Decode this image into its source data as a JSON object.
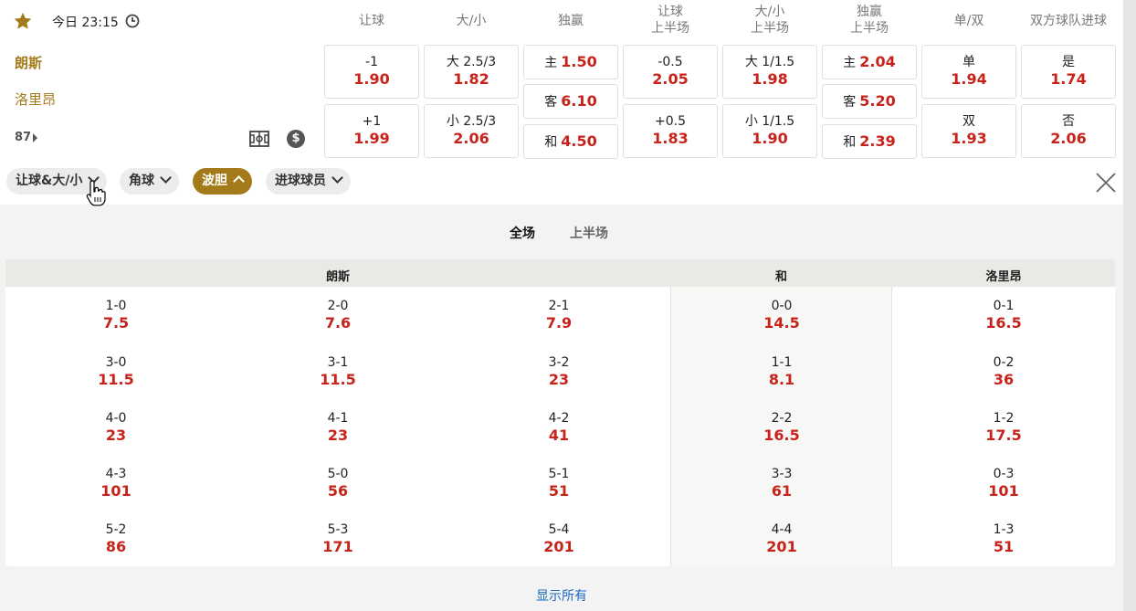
{
  "match": {
    "time": "今日 23:15",
    "home": "朗斯",
    "away": "洛里昂",
    "minute": "87"
  },
  "markets": [
    {
      "header": [
        "让球"
      ],
      "cells": [
        {
          "label": "-1",
          "odd": "1.90"
        },
        {
          "label": "+1",
          "odd": "1.99"
        }
      ]
    },
    {
      "header": [
        "大/小"
      ],
      "cells": [
        {
          "label": "大 2.5/3",
          "odd": "1.82"
        },
        {
          "label": "小 2.5/3",
          "odd": "2.06"
        }
      ]
    },
    {
      "header": [
        "独赢"
      ],
      "cells": [
        {
          "label": "主",
          "odd": "1.50"
        },
        {
          "label": "客",
          "odd": "6.10"
        },
        {
          "label": "和",
          "odd": "4.50"
        }
      ]
    },
    {
      "header": [
        "让球",
        "上半场"
      ],
      "cells": [
        {
          "label": "-0.5",
          "odd": "2.05"
        },
        {
          "label": "+0.5",
          "odd": "1.83"
        }
      ]
    },
    {
      "header": [
        "大/小",
        "上半场"
      ],
      "cells": [
        {
          "label": "大 1/1.5",
          "odd": "1.98"
        },
        {
          "label": "小 1/1.5",
          "odd": "1.90"
        }
      ]
    },
    {
      "header": [
        "独赢",
        "上半场"
      ],
      "cells": [
        {
          "label": "主",
          "odd": "2.04"
        },
        {
          "label": "客",
          "odd": "5.20"
        },
        {
          "label": "和",
          "odd": "2.39"
        }
      ]
    },
    {
      "header": [
        "单/双"
      ],
      "cells": [
        {
          "label": "单",
          "odd": "1.94"
        },
        {
          "label": "双",
          "odd": "1.93"
        }
      ]
    },
    {
      "header": [
        "双方球队进球"
      ],
      "cells": [
        {
          "label": "是",
          "odd": "1.74"
        },
        {
          "label": "否",
          "odd": "2.06"
        }
      ]
    }
  ],
  "chips": [
    {
      "label": "让球&大/小",
      "active": false
    },
    {
      "label": "角球",
      "active": false
    },
    {
      "label": "波胆",
      "active": true
    },
    {
      "label": "进球球员",
      "active": false
    }
  ],
  "tabs": [
    "全场",
    "上半场"
  ],
  "grid_headers": {
    "home": "朗斯",
    "draw": "和",
    "away": "洛里昂"
  },
  "scores": [
    [
      {
        "s": "1-0",
        "o": "7.5"
      },
      {
        "s": "2-0",
        "o": "7.6"
      },
      {
        "s": "2-1",
        "o": "7.9"
      },
      {
        "s": "0-0",
        "o": "14.5"
      },
      {
        "s": "0-1",
        "o": "16.5"
      }
    ],
    [
      {
        "s": "3-0",
        "o": "11.5"
      },
      {
        "s": "3-1",
        "o": "11.5"
      },
      {
        "s": "3-2",
        "o": "23"
      },
      {
        "s": "1-1",
        "o": "8.1"
      },
      {
        "s": "0-2",
        "o": "36"
      }
    ],
    [
      {
        "s": "4-0",
        "o": "23"
      },
      {
        "s": "4-1",
        "o": "23"
      },
      {
        "s": "4-2",
        "o": "41"
      },
      {
        "s": "2-2",
        "o": "16.5"
      },
      {
        "s": "1-2",
        "o": "17.5"
      }
    ],
    [
      {
        "s": "4-3",
        "o": "101"
      },
      {
        "s": "5-0",
        "o": "56"
      },
      {
        "s": "5-1",
        "o": "51"
      },
      {
        "s": "3-3",
        "o": "61"
      },
      {
        "s": "0-3",
        "o": "101"
      }
    ],
    [
      {
        "s": "5-2",
        "o": "86"
      },
      {
        "s": "5-3",
        "o": "171"
      },
      {
        "s": "5-4",
        "o": "201"
      },
      {
        "s": "4-4",
        "o": "201"
      },
      {
        "s": "1-3",
        "o": "51"
      }
    ]
  ],
  "show_all": "显示所有",
  "colors": {
    "accent": "#a37b1a",
    "odds": "#c8231a",
    "link": "#1a6ac0"
  },
  "icons": [
    "star-icon",
    "clock-icon",
    "play-arrow-icon",
    "pitch-icon",
    "dollar-icon",
    "chevron-down-icon",
    "chevron-up-icon",
    "close-icon",
    "hand-cursor-icon"
  ]
}
